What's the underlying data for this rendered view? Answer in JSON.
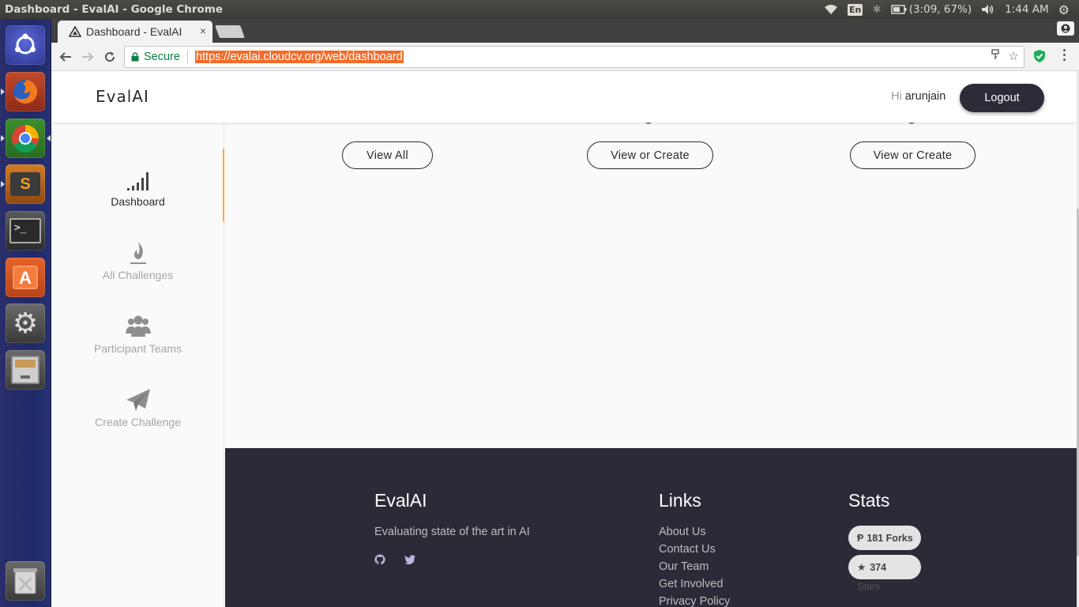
{
  "os": {
    "window_title": "Dashboard - EvalAI - Google Chrome",
    "keyboard_layout": "En",
    "battery": "(3:09, 67%)",
    "clock": "1:44 AM"
  },
  "launcher": {
    "items": [
      "ubuntu-dash",
      "firefox",
      "chrome",
      "sublime-text",
      "terminal",
      "software-center",
      "system-settings",
      "file-cabinet",
      "trash"
    ]
  },
  "browser": {
    "tab_title": "Dashboard - EvalAI",
    "tab_close": "×",
    "secure_label": "Secure",
    "url": "https://evalai.cloudcv.org/web/dashboard"
  },
  "header": {
    "logo": "EvalAI",
    "greeting_prefix": "Hi",
    "username": "arunjain",
    "logout_label": "Logout"
  },
  "sidebar": {
    "items": [
      {
        "label": "Dashboard",
        "icon": "signal-bars-icon",
        "active": true
      },
      {
        "label": "All Challenges",
        "icon": "flame-icon",
        "active": false
      },
      {
        "label": "Participant Teams",
        "icon": "users-icon",
        "active": false
      },
      {
        "label": "Create Challenge",
        "icon": "paper-plane-icon",
        "active": false
      }
    ]
  },
  "main": {
    "buttons": [
      "View All",
      "View or Create",
      "View or Create"
    ]
  },
  "footer": {
    "brand": "EvalAI",
    "tagline": "Evaluating state of the art in AI",
    "social": [
      "github-icon",
      "twitter-icon"
    ],
    "links_heading": "Links",
    "links": [
      "About Us",
      "Contact Us",
      "Our Team",
      "Get Involved",
      "Privacy Policy"
    ],
    "stats_heading": "Stats",
    "forks": "181 Forks",
    "stars": "374",
    "stars_caption": "Stars"
  },
  "colors": {
    "accent": "#ffaa33",
    "footer_bg": "#2b2b37",
    "logout_bg": "#2c2b37",
    "url_highlight": "#f46c2a",
    "secure_green": "#0b8043"
  }
}
